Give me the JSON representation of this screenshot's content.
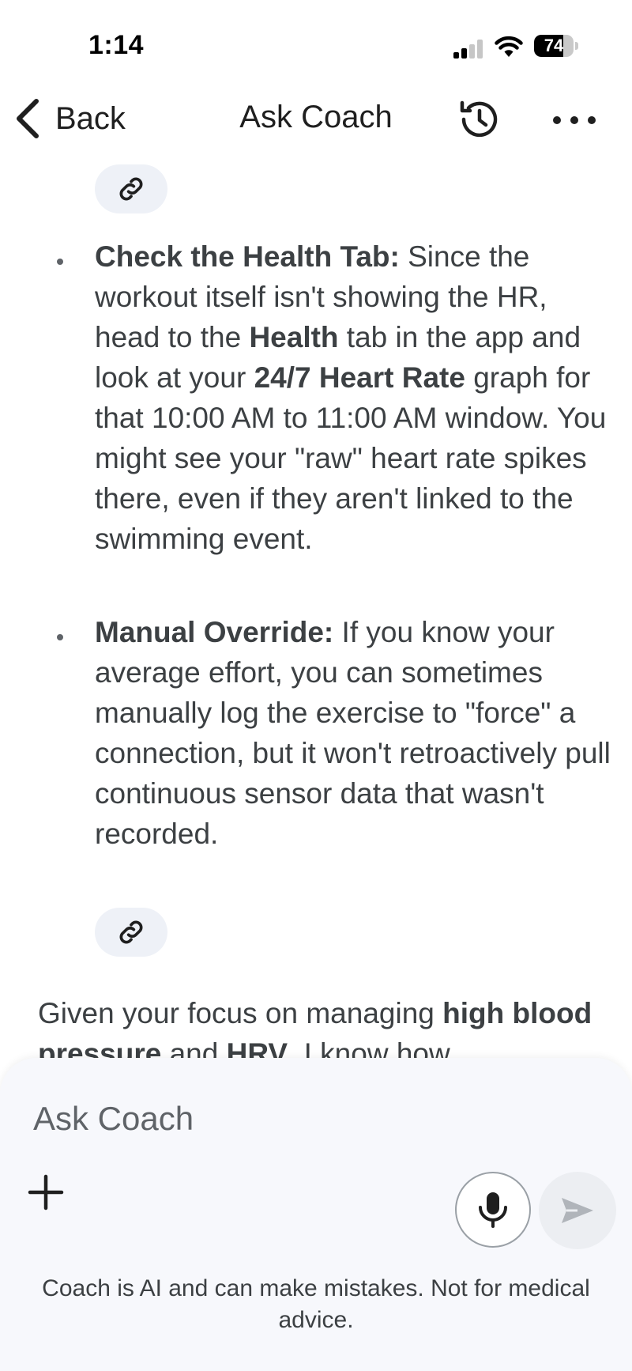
{
  "status_bar": {
    "time": "1:14",
    "battery_level": "74",
    "battery_fraction": 0.74
  },
  "header": {
    "back_label": "Back",
    "title": "Ask Coach",
    "back_icon": "chevron-left-icon",
    "history_icon": "history-icon",
    "more_icon": "more-horizontal-icon"
  },
  "chat": {
    "bullets": [
      {
        "segments": [
          {
            "text": "Check the Health Tab:",
            "bold": true
          },
          {
            "text": " Since the workout itself isn't showing the HR, head to the ",
            "bold": false
          },
          {
            "text": "Health",
            "bold": true
          },
          {
            "text": " tab in the app and look at your ",
            "bold": false
          },
          {
            "text": "24/7 Heart Rate",
            "bold": true
          },
          {
            "text": " graph for that 10:00 AM to 11:00 AM window. You might see your \"raw\" heart rate spikes there, even if they aren't linked to the swimming event.",
            "bold": false
          }
        ]
      },
      {
        "segments": [
          {
            "text": "Manual Override:",
            "bold": true
          },
          {
            "text": " If you know your average effort, you can sometimes manually log the exercise to \"force\" a connection, but it won't retroactively pull continuous sensor data that wasn't recorded.",
            "bold": false
          }
        ]
      }
    ],
    "closing_paragraph": {
      "segments": [
        {
          "text": "Given your focus on managing ",
          "bold": false
        },
        {
          "text": "high blood pressure",
          "bold": true
        },
        {
          "text": " and ",
          "bold": false
        },
        {
          "text": "HRV",
          "bold": true
        },
        {
          "text": ", I know how",
          "bold": false
        }
      ]
    },
    "source_icon": "link-icon"
  },
  "composer": {
    "placeholder": "Ask Coach",
    "value": "",
    "disclaimer": "Coach is AI and can make mistakes. Not for medical advice.",
    "plus_icon": "plus-icon",
    "mic_icon": "microphone-icon",
    "send_icon": "send-icon"
  },
  "colors": {
    "text": "#3c4043",
    "chip_bg": "#eef1f7",
    "composer_bg": "#f7f8fc",
    "send_disabled": "#b0b4ba"
  }
}
